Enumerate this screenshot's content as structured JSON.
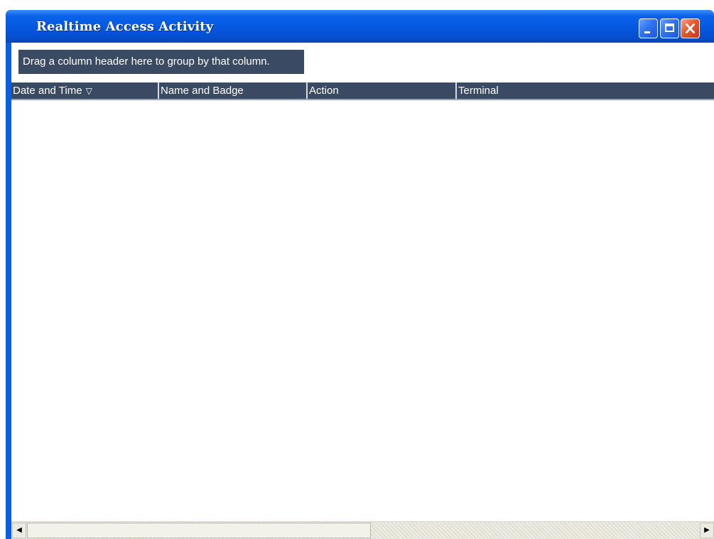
{
  "window": {
    "title": "Realtime Access Activity",
    "controls": {
      "minimize_icon": "minimize-icon",
      "maximize_icon": "maximize-icon",
      "close_icon": "close-icon"
    },
    "colors": {
      "titlebar": "#0657e0",
      "close_button": "#e4582f",
      "grid_header": "#3b4a63"
    }
  },
  "grid": {
    "group_hint": "Drag a column header here to group by that column.",
    "columns": [
      {
        "label": "Date and Time",
        "sorted": "descending",
        "sort_icon": "▽"
      },
      {
        "label": "Name and Badge"
      },
      {
        "label": "Action"
      },
      {
        "label": "Terminal"
      }
    ],
    "rows": []
  },
  "scrollbar": {
    "left_arrow": "◀",
    "right_arrow": "▶"
  }
}
